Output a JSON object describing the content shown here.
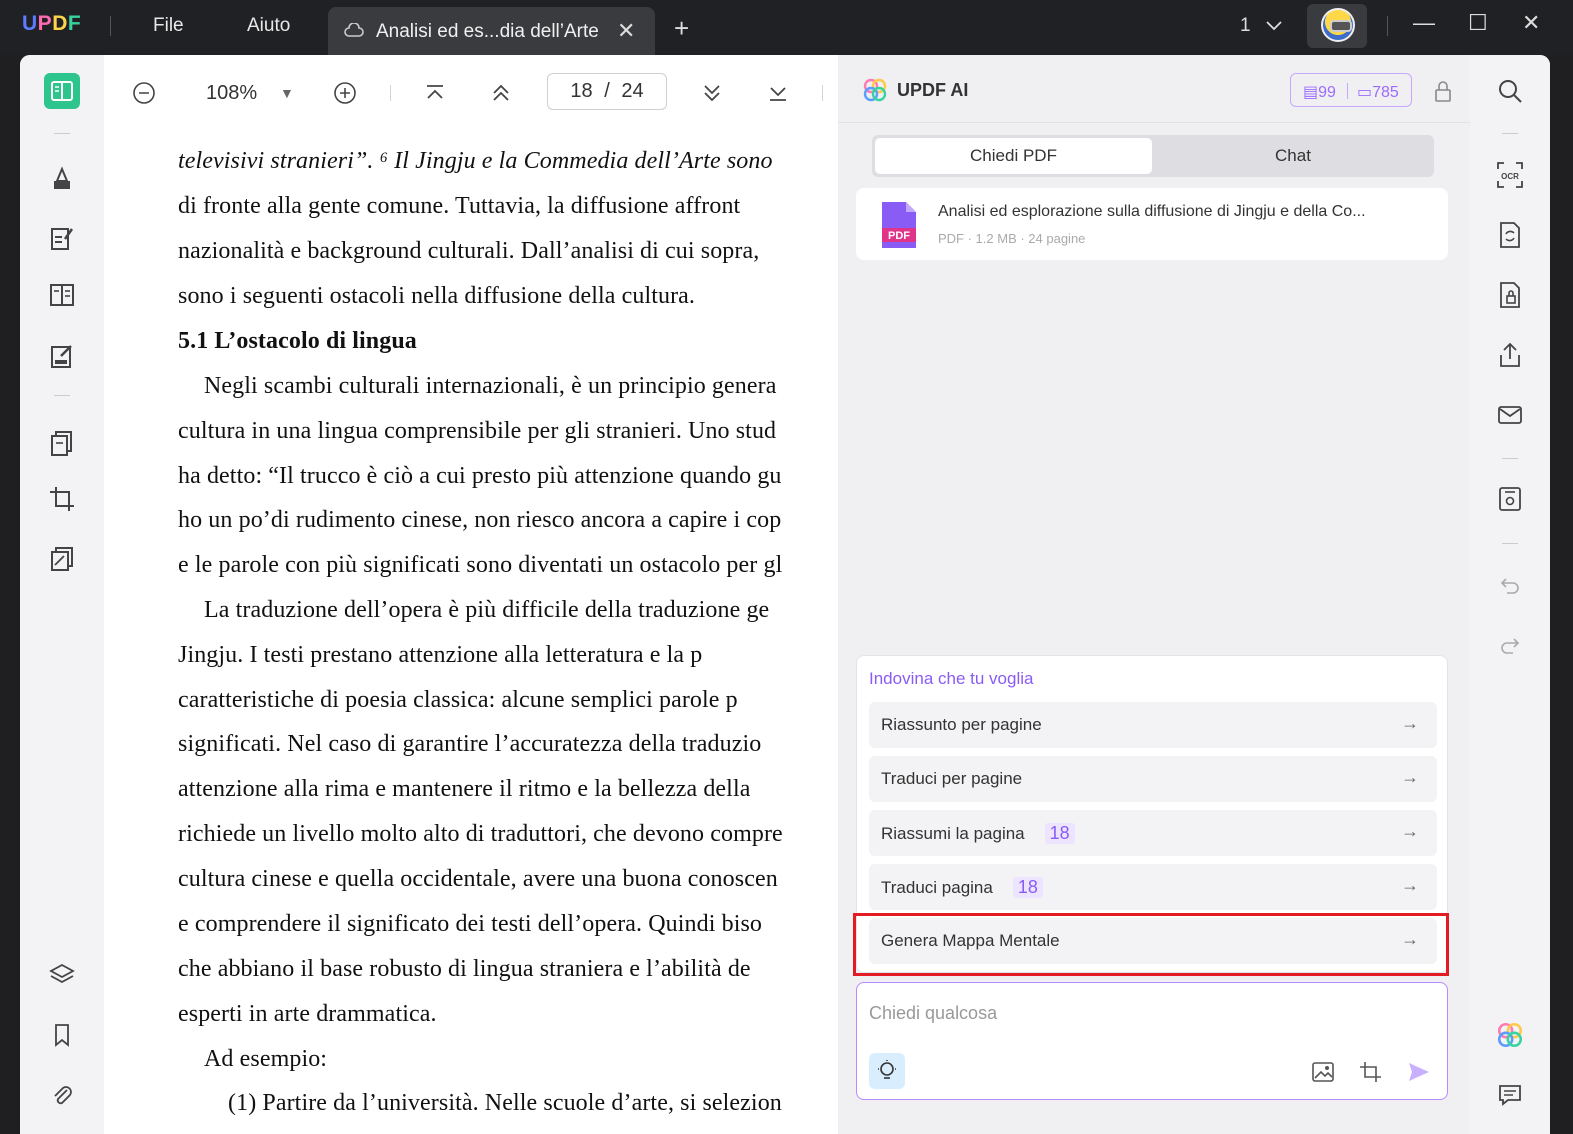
{
  "app": {
    "logo_letters": [
      "U",
      "P",
      "D",
      "F"
    ],
    "menu": [
      "File",
      "Aiuto"
    ],
    "tab_title": "Analisi ed es...dia dell’Arte",
    "tab_close": "✕",
    "new_tab": "+",
    "window_count": "1",
    "controls": [
      "—",
      "☐",
      "✕"
    ]
  },
  "doc_toolbar": {
    "zoom": "108%",
    "zoom_caret": "▼",
    "page_current": "18",
    "page_total": "24",
    "page_sep": "/"
  },
  "document": {
    "lines": [
      {
        "text": "televisivi stranieri”. ⁶ Il Jingju e la Commedia dell’Arte sono",
        "style": "mixed"
      },
      {
        "text": "di fronte alla gente comune. Tuttavia, la diffusione affront",
        "style": "normal"
      },
      {
        "text": "nazionalità e background culturali. Dall’analisi di cui sopra,",
        "style": "normal"
      },
      {
        "text": "sono i seguenti ostacoli nella diffusione della cultura.",
        "style": "normal"
      },
      {
        "text": "5.1 L’ostacolo di lingua",
        "style": "bold"
      },
      {
        "text": "Negli scambi culturali internazionali, è un principio genera",
        "style": "indent"
      },
      {
        "text": "cultura in una lingua comprensibile per gli stranieri. Uno stud",
        "style": "normal"
      },
      {
        "text": "ha detto: “Il trucco è ciò a cui presto più attenzione quando gu",
        "style": "normal"
      },
      {
        "text": "ho un po’di rudimento cinese, non riesco ancora a capire i cop",
        "style": "normal"
      },
      {
        "text": "e le parole con più significati sono diventati un ostacolo per gl",
        "style": "normal"
      },
      {
        "text": "La traduzione dell’opera è più difficile della traduzione ge",
        "style": "indent"
      },
      {
        "text": "Jingju. I testi prestano attenzione alla letteratura e la p",
        "style": "normal"
      },
      {
        "text": "caratteristiche di poesia classica: alcune semplici parole p",
        "style": "normal"
      },
      {
        "text": "significati. Nel caso di garantire l’accuratezza della traduzio",
        "style": "normal"
      },
      {
        "text": "attenzione alla rima e mantenere il ritmo e la bellezza della",
        "style": "normal"
      },
      {
        "text": "richiede un livello molto alto di traduttori, che devono compre",
        "style": "normal"
      },
      {
        "text": "cultura cinese e quella occidentale, avere una buona conoscen",
        "style": "normal"
      },
      {
        "text": "e comprendere il significato dei testi dell’opera. Quindi biso",
        "style": "normal"
      },
      {
        "text": "che abbiano il base robusto di lingua straniera e l’abilità de",
        "style": "normal"
      },
      {
        "text": "esperti in arte drammatica.",
        "style": "normal"
      },
      {
        "text": "Ad esempio:",
        "style": "indent"
      },
      {
        "text": "(1) Partire da l’università. Nelle scuole d’arte, si selezion",
        "style": "indent2"
      }
    ]
  },
  "ai_panel": {
    "title": "UPDF AI",
    "credits_pdf": "99",
    "credits_chat": "785",
    "tabs": [
      "Chiedi PDF",
      "Chat"
    ],
    "file": {
      "name": "Analisi ed esplorazione sulla diffusione di Jingju e della Co...",
      "meta": "PDF · 1.2 MB · 24 pagine",
      "icon_label": "PDF"
    },
    "suggestions_title": "Indovina che tu voglia",
    "suggestions": [
      {
        "label": "Riassunto per pagine",
        "badge": ""
      },
      {
        "label": "Traduci per pagine",
        "badge": ""
      },
      {
        "label": "Riassumi la pagina",
        "badge": "18"
      },
      {
        "label": "Traduci pagina",
        "badge": "18"
      },
      {
        "label": "Genera Mappa Mentale",
        "badge": ""
      }
    ],
    "arrow": "→",
    "input_placeholder": "Chiedi qualcosa"
  },
  "colors": {
    "accent_purple": "#8a5cf6",
    "highlight_red": "#e31b23",
    "active_green": "#2dc48d"
  }
}
